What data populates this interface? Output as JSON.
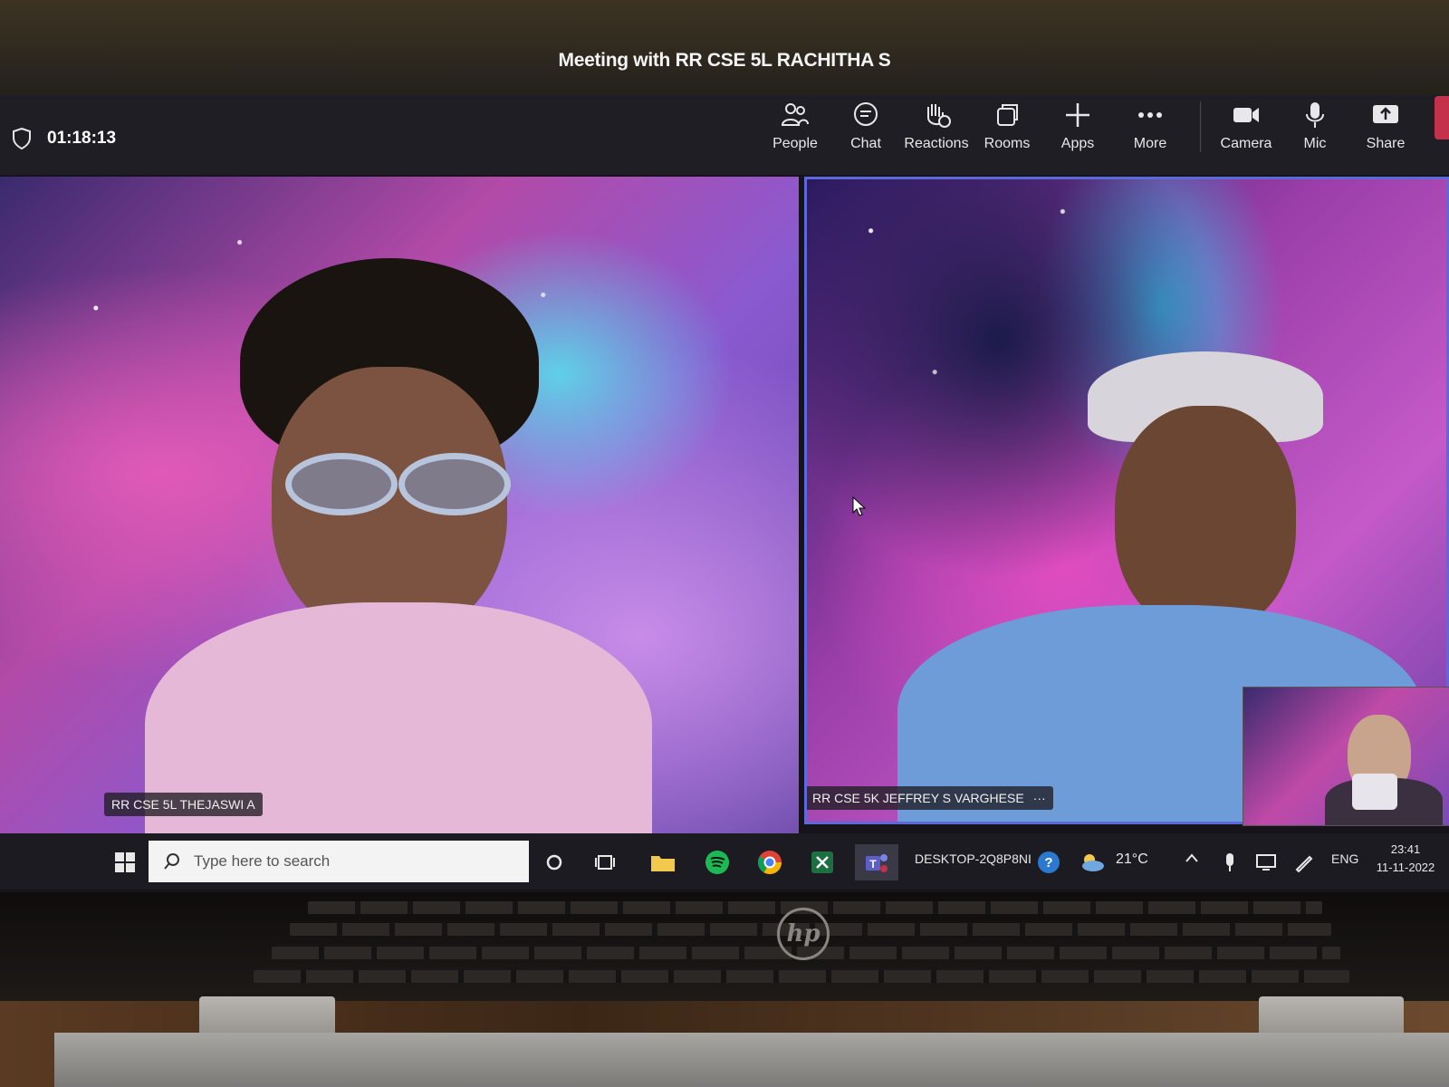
{
  "window": {
    "title": "Meeting with RR CSE 5L RACHITHA S"
  },
  "meeting": {
    "timer": "01:18:13"
  },
  "toolbar": {
    "people": "People",
    "chat": "Chat",
    "reactions": "Reactions",
    "rooms": "Rooms",
    "apps": "Apps",
    "more": "More",
    "camera": "Camera",
    "mic": "Mic",
    "share": "Share"
  },
  "participants": [
    {
      "name": "RR CSE 5L THEJASWI A"
    },
    {
      "name": "RR CSE 5K JEFFREY S VARGHESE",
      "more": "···"
    }
  ],
  "taskbar": {
    "search_placeholder": "Type here to search",
    "device": "DESKTOP-2Q8P8NI",
    "temperature": "21°C",
    "language": "ENG",
    "time": "23:41",
    "date": "11-11-2022"
  },
  "laptop": {
    "logo": "hp"
  },
  "colors": {
    "accent": "#5b6ad8",
    "leave": "#c4314b",
    "camera_bg": "#b24aa8"
  }
}
